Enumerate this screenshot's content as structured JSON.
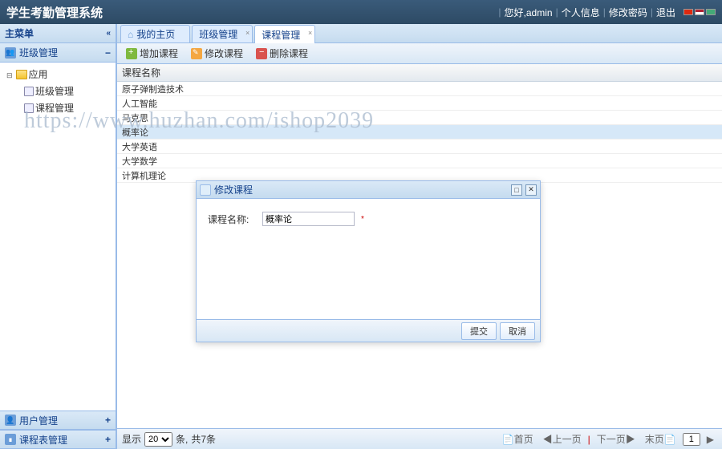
{
  "header": {
    "title": "学生考勤管理系统",
    "greeting": "您好,admin",
    "links": {
      "profile": "个人信息",
      "changepwd": "修改密码",
      "logout": "退出"
    }
  },
  "sidebar": {
    "title": "主菜单",
    "accordion": {
      "classMgmt": "班级管理",
      "userMgmt": "用户管理",
      "scheduleMgmt": "课程表管理"
    },
    "tree": {
      "root": "应用",
      "children": {
        "classMgmt": "班级管理",
        "courseMgmt": "课程管理"
      }
    }
  },
  "tabs": {
    "home": "我的主页",
    "classMgmt": "班级管理",
    "courseMgmt": "课程管理"
  },
  "toolbar": {
    "add": "增加课程",
    "edit": "修改课程",
    "delete": "删除课程"
  },
  "grid": {
    "header": "课程名称",
    "rows": [
      "原子弹制造技术",
      "人工智能",
      "马克思",
      "概率论",
      "大学英语",
      "大学数学",
      "计算机理论"
    ]
  },
  "pager": {
    "showLabel": "显示",
    "pageSize": "20",
    "unitLabel": "条,",
    "totalLabel": "共7条",
    "first": "首页",
    "prev": "上一页",
    "next": "下一页",
    "last": "末页",
    "page": "1"
  },
  "dialog": {
    "title": "修改课程",
    "fieldLabel": "课程名称:",
    "fieldValue": "概率论",
    "submit": "提交",
    "cancel": "取消"
  },
  "watermark": "https://www.huzhan.com/ishop2039"
}
